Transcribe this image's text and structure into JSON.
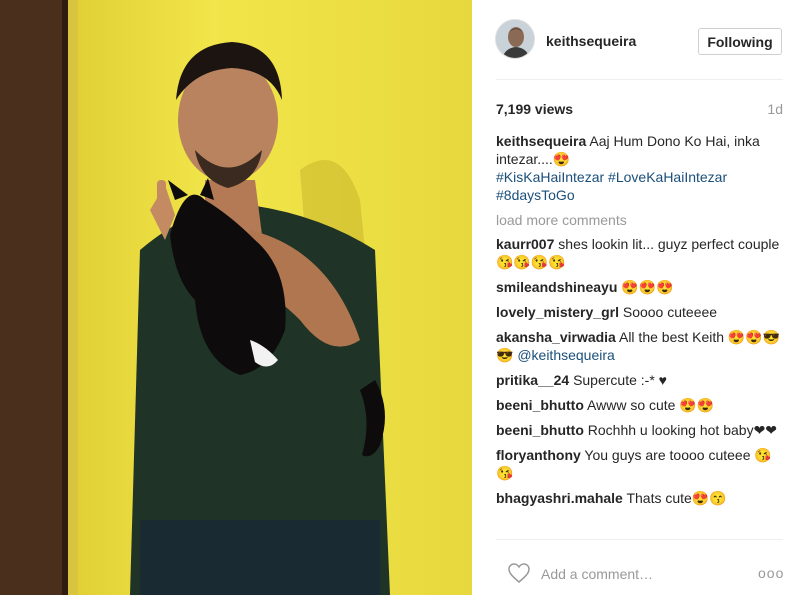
{
  "post": {
    "username": "keithsequeira",
    "follow_label": "Following",
    "views": "7,199 views",
    "time": "1d",
    "caption": {
      "user": "keithsequeira",
      "text": "Aaj Hum Dono Ko Hai, inka intezar....😍",
      "hashtags": "#KisKaHaiIntezar #LoveKaHaiIntezar #8daysToGo"
    },
    "load_more": "load more comments",
    "comments": [
      {
        "user": "kaurr007",
        "text": "shes lookin lit... guyz perfect couple 😘😘😘😘"
      },
      {
        "user": "smileandshineayu",
        "text": "😍😍😍"
      },
      {
        "user": "lovely_mistery_grl",
        "text": "Soooo cuteeee"
      },
      {
        "user": "akansha_virwadia",
        "text": "All the best Keith 😍😍😎😎",
        "mention": "@keithsequeira"
      },
      {
        "user": "pritika__24",
        "text": "Supercute :-* ♥"
      },
      {
        "user": "beeni_bhutto",
        "text": "Awww so cute 😍😍"
      },
      {
        "user": "beeni_bhutto",
        "text": "Rochhh u looking hot baby❤❤"
      },
      {
        "user": "floryanthony",
        "text": "You guys are toooo cuteee 😘😘"
      },
      {
        "user": "bhagyashri.mahale",
        "text": "Thats cute😍😙"
      }
    ],
    "comment_placeholder": "Add a comment…",
    "more_label": "ooo"
  }
}
